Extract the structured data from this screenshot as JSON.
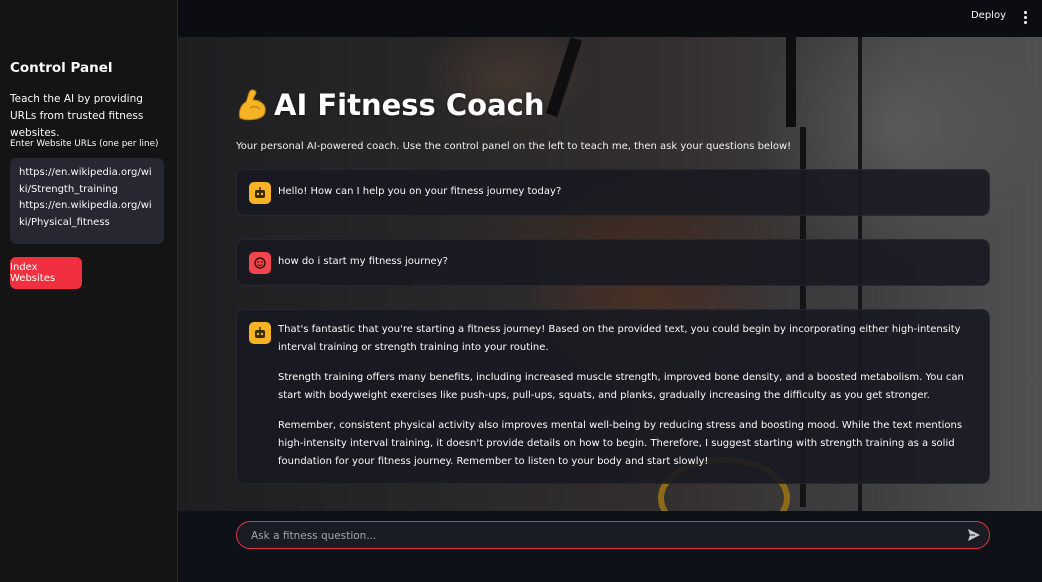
{
  "sidebar": {
    "title": "Control Panel",
    "description": "Teach the AI by providing URLs from trusted fitness websites.",
    "urls_label": "Enter Website URLs (one per line)",
    "urls_value": "https://en.wikipedia.org/wiki/Strength_training\nhttps://en.wikipedia.org/wiki/Physical_fitness",
    "index_button": "Index Websites"
  },
  "header": {
    "deploy_label": "Deploy",
    "menu_icon": "kebab-menu-icon"
  },
  "main": {
    "title": "AI Fitness Coach",
    "title_icon": "flexed-biceps-emoji",
    "subtitle": "Your personal AI-powered coach. Use the control panel on the left to teach me, then ask your questions below!",
    "messages": [
      {
        "role": "assistant",
        "icon": "robot-icon",
        "paragraphs": [
          "Hello! How can I help you on your fitness journey today?"
        ]
      },
      {
        "role": "user",
        "icon": "user-face-icon",
        "paragraphs": [
          "how do i start my fitness journey?"
        ]
      },
      {
        "role": "assistant",
        "icon": "robot-icon",
        "paragraphs": [
          "That's fantastic that you're starting a fitness journey! Based on the provided text, you could begin by incorporating either high-intensity interval training or strength training into your routine.",
          "Strength training offers many benefits, including increased muscle strength, improved bone density, and a boosted metabolism. You can start with bodyweight exercises like push-ups, pull-ups, squats, and planks, gradually increasing the difficulty as you get stronger.",
          "Remember, consistent physical activity also improves mental well-being by reducing stress and boosting mood. While the text mentions high-intensity interval training, it doesn't provide details on how to begin. Therefore, I suggest starting with strength training as a solid foundation for your fitness journey. Remember to listen to your body and start slowly!"
        ]
      }
    ]
  },
  "chat_input": {
    "placeholder": "Ask a fitness question...",
    "send_icon": "send-icon"
  },
  "colors": {
    "accent": "#f0303e",
    "bot_avatar": "#f6b324",
    "user_avatar": "#f0464c",
    "sidebar_bg": "#141414",
    "app_bg": "#0e1117"
  }
}
